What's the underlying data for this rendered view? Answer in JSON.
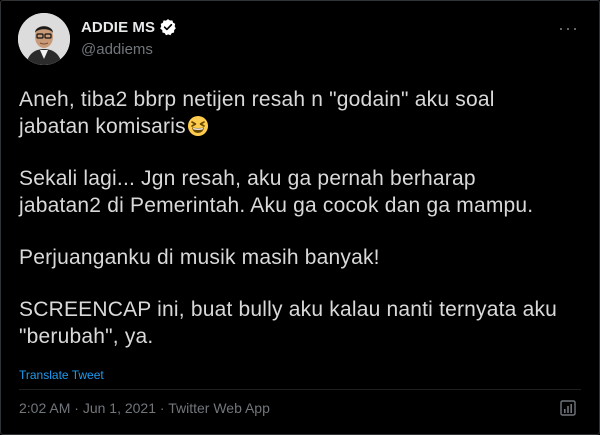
{
  "author": {
    "name": "ADDIE MS",
    "handle": "@addiems",
    "verified": true
  },
  "more_icon": "more-horizontal-icon",
  "tweet": {
    "line1": "Aneh, tiba2 bbrp netijen resah n \"godain\" aku soal",
    "line2": "jabatan komisaris",
    "emoji": "grinning-squinting-face",
    "line3": "Sekali lagi... Jgn resah, aku ga pernah berharap",
    "line4": "jabatan2 di Pemerintah. Aku ga cocok dan ga mampu.",
    "line5": "Perjuanganku di musik masih banyak!",
    "line6": "SCREENCAP ini, buat bully aku kalau nanti ternyata aku",
    "line7": "\"berubah\", ya."
  },
  "translate_label": "Translate Tweet",
  "meta": {
    "time": "2:02 AM",
    "separator": " · ",
    "date": "Jun 1, 2021",
    "source": "Twitter Web App"
  },
  "colors": {
    "background": "#000000",
    "link": "#1d9bf0",
    "muted": "#71767b",
    "verified": "#ffffff"
  }
}
